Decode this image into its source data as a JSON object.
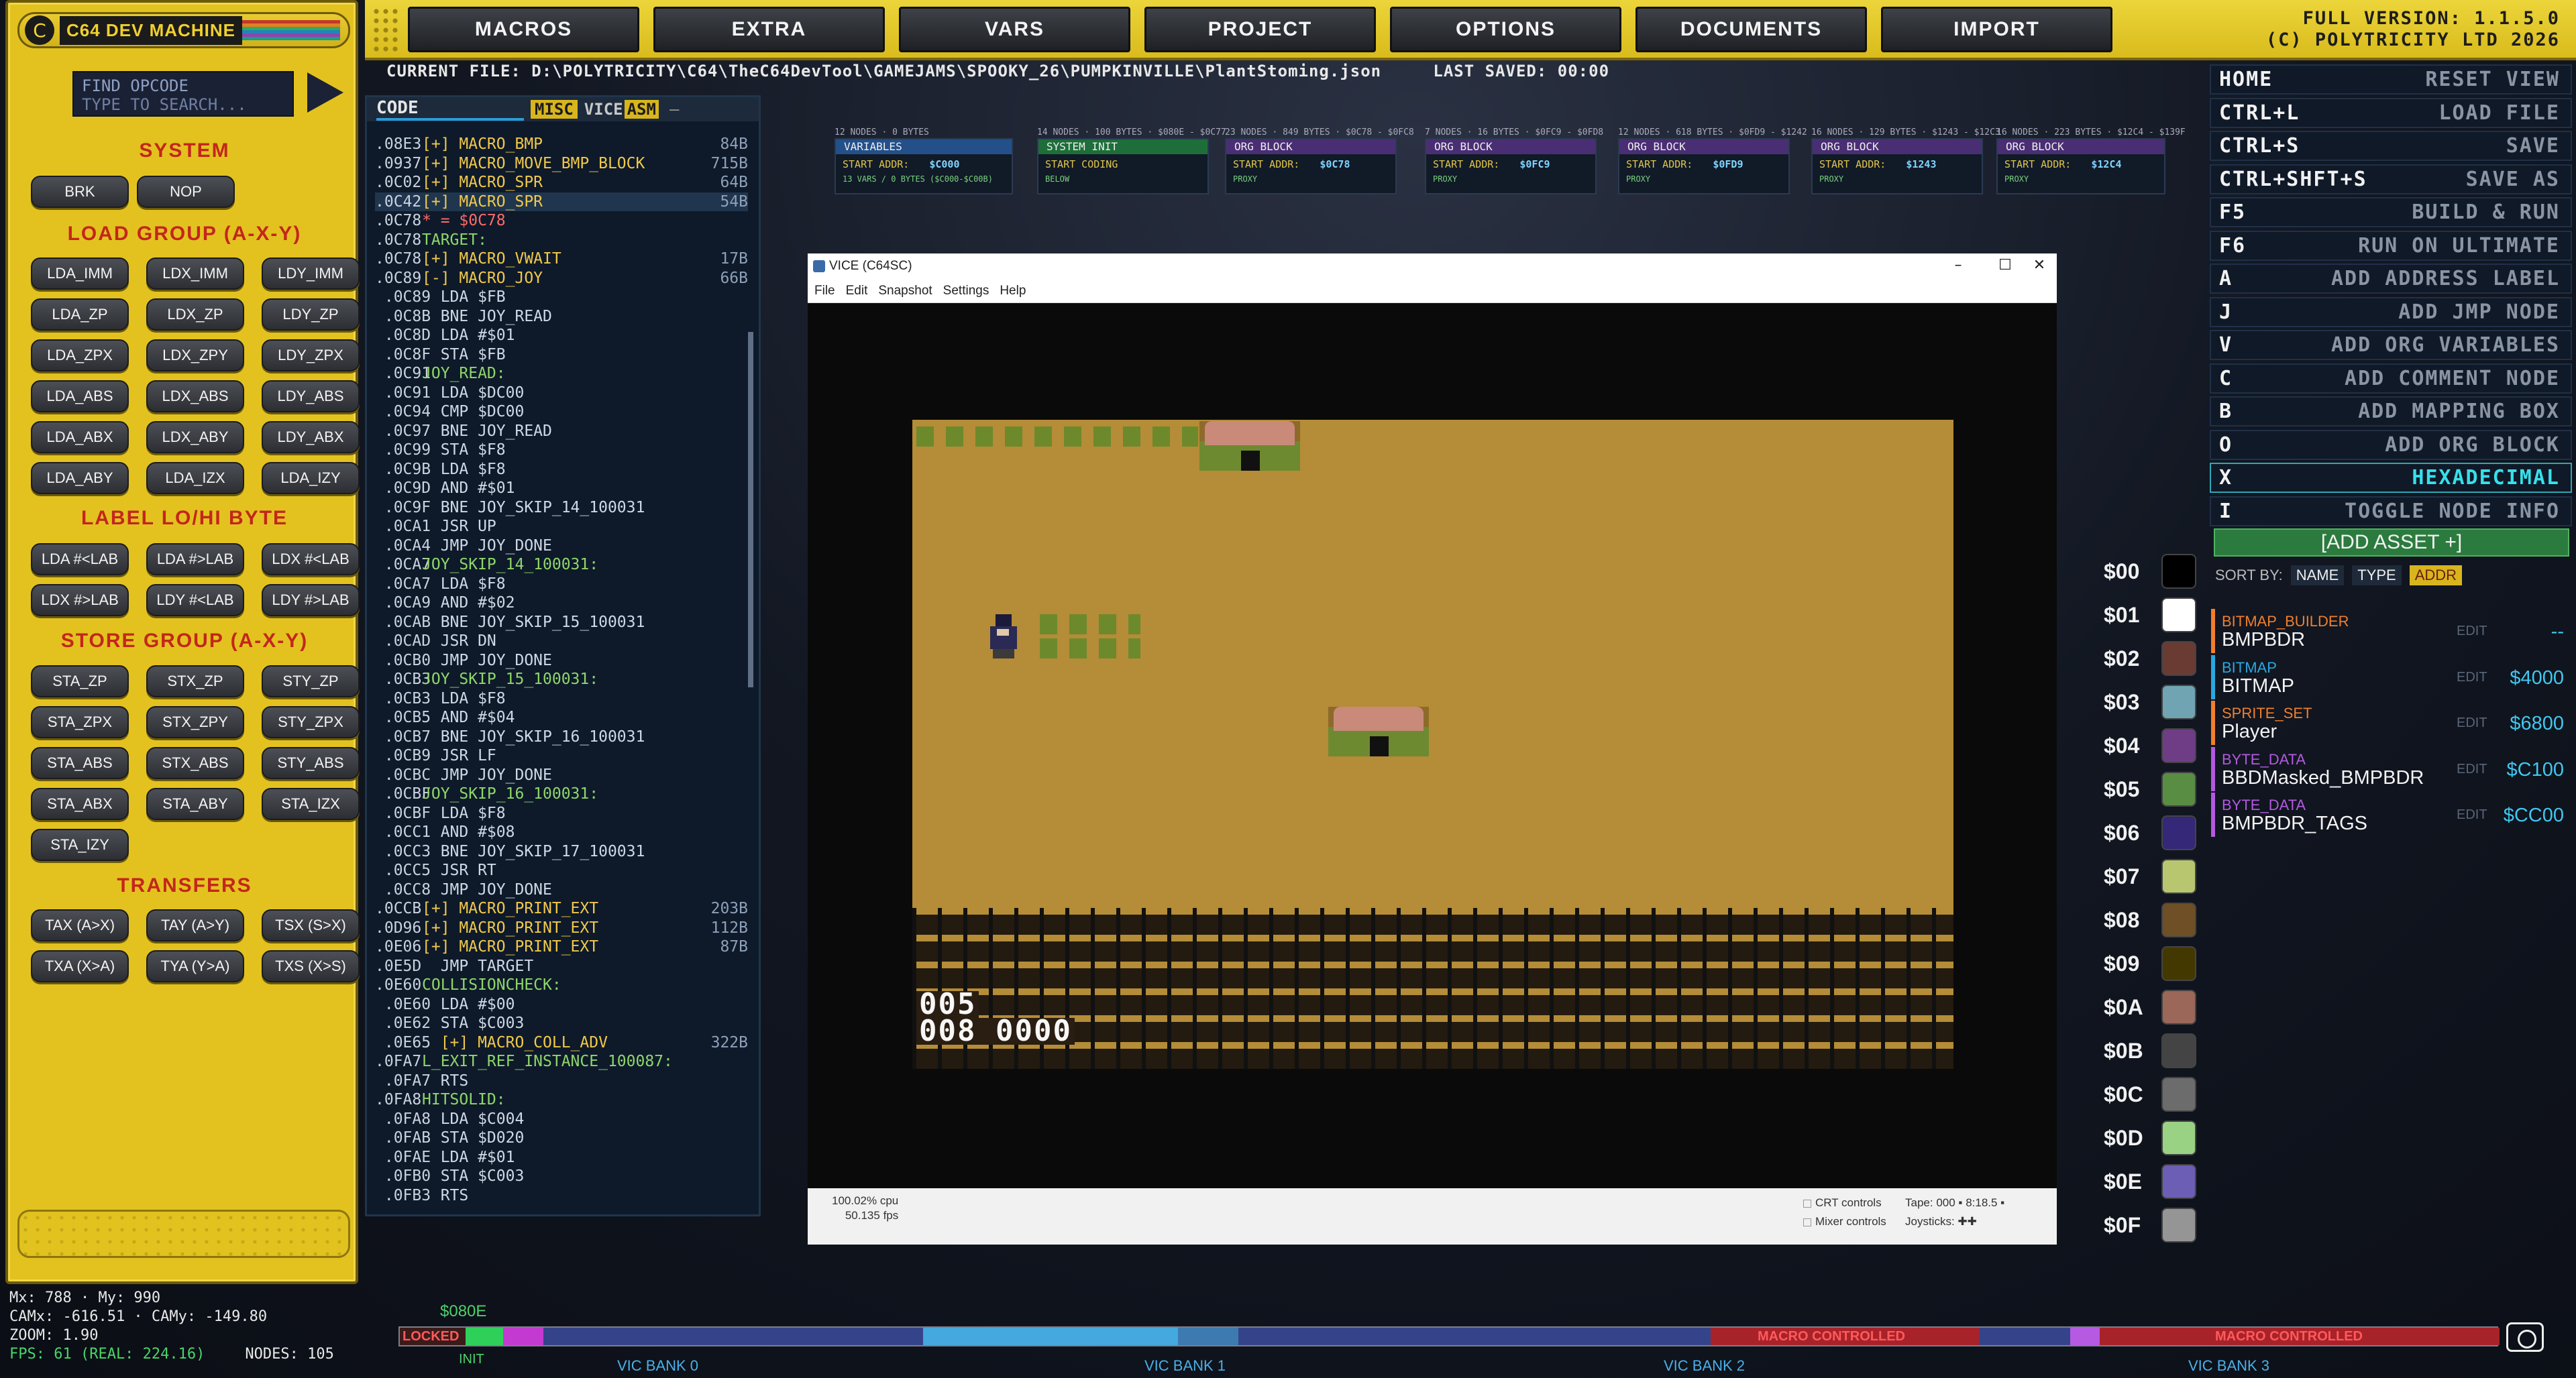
{
  "app": {
    "title": "C64 DEV MACHINE",
    "version_line1": "FULL VERSION: 1.1.5.0",
    "version_line2": "(C) POLYTRICITY LTD 2026"
  },
  "menu": [
    "MACROS",
    "EXTRA",
    "VARS",
    "PROJECT",
    "OPTIONS",
    "DOCUMENTS",
    "IMPORT"
  ],
  "file": {
    "label": "CURRENT FILE: D:\\POLYTRICITY\\C64\\TheC64DevTool\\GAMEJAMS\\SPOOKY_26\\PUMPKINVILLE\\PlantStoming.json",
    "saved": "LAST SAVED: 00:00"
  },
  "search": {
    "label": "FIND OPCODE",
    "placeholder": "TYPE TO SEARCH..."
  },
  "sections": {
    "system": "SYSTEM",
    "load": "LOAD GROUP (A-X-Y)",
    "label": "LABEL LO/HI BYTE",
    "store": "STORE GROUP (A-X-Y)",
    "transfers": "TRANSFERS"
  },
  "ops": {
    "system": [
      "BRK",
      "NOP"
    ],
    "load": [
      "LDA_IMM",
      "LDX_IMM",
      "LDY_IMM",
      "LDA_ZP",
      "LDX_ZP",
      "LDY_ZP",
      "LDA_ZPX",
      "LDX_ZPY",
      "LDY_ZPX",
      "LDA_ABS",
      "LDX_ABS",
      "LDY_ABS",
      "LDA_ABX",
      "LDX_ABY",
      "LDY_ABX",
      "LDA_ABY",
      "LDA_IZX",
      "LDA_IZY"
    ],
    "label": [
      "LDA #<LAB",
      "LDA #>LAB",
      "LDX #<LAB",
      "LDX #>LAB",
      "LDY #<LAB",
      "LDY #>LAB"
    ],
    "store": [
      "STA_ZP",
      "STX_ZP",
      "STY_ZP",
      "STA_ZPX",
      "STX_ZPY",
      "STY_ZPX",
      "STA_ABS",
      "STX_ABS",
      "STY_ABS",
      "STA_ABX",
      "STA_ABY",
      "STA_IZX",
      "STA_IZY"
    ],
    "transfers": [
      "TAX (A>X)",
      "TAY (A>Y)",
      "TSX (S>X)",
      "TXA (X>A)",
      "TYA (Y>A)",
      "TXS (X>S)"
    ]
  },
  "code_tabs": {
    "code": "CODE",
    "misc": "MISC",
    "vice": "VICE",
    "asm": "ASM",
    "dash": "—"
  },
  "code": [
    {
      "a": ".08E3",
      "t": "[+] MACRO_BMP",
      "s": "84B",
      "k": "macro"
    },
    {
      "a": ".0937",
      "t": "[+] MACRO_MOVE_BMP_BLOCK",
      "s": "715B",
      "k": "macro"
    },
    {
      "a": ".0C02",
      "t": "[+] MACRO_SPR",
      "s": "64B",
      "k": "macro"
    },
    {
      "a": ".0C42",
      "t": "[+] MACRO_SPR",
      "s": "54B",
      "k": "macro",
      "h": true
    },
    {
      "a": ".0C78",
      "t": "* = $0C78",
      "s": "",
      "k": "red"
    },
    {
      "a": ".0C78",
      "t": "TARGET:",
      "s": "",
      "k": "label",
      "n": true
    },
    {
      "a": ".0C78",
      "t": "[+] MACRO_VWAIT",
      "s": "17B",
      "k": "macro"
    },
    {
      "a": ".0C89",
      "t": "[-] MACRO_JOY",
      "s": "66B",
      "k": "macro"
    },
    {
      "a": " .0C89",
      "t": "  LDA $FB",
      "s": "",
      "k": "op"
    },
    {
      "a": " .0C8B",
      "t": "  BNE JOY_READ",
      "s": "",
      "k": "op"
    },
    {
      "a": " .0C8D",
      "t": "  LDA #$01",
      "s": "",
      "k": "op"
    },
    {
      "a": " .0C8F",
      "t": "  STA $FB",
      "s": "",
      "k": "op"
    },
    {
      "a": " .0C91",
      "t": "JOY_READ:",
      "s": "",
      "k": "label"
    },
    {
      "a": " .0C91",
      "t": "  LDA $DC00",
      "s": "",
      "k": "op"
    },
    {
      "a": " .0C94",
      "t": "  CMP $DC00",
      "s": "",
      "k": "op"
    },
    {
      "a": " .0C97",
      "t": "  BNE JOY_READ",
      "s": "",
      "k": "op"
    },
    {
      "a": " .0C99",
      "t": "  STA $F8",
      "s": "",
      "k": "op"
    },
    {
      "a": " .0C9B",
      "t": "  LDA $F8",
      "s": "",
      "k": "op"
    },
    {
      "a": " .0C9D",
      "t": "  AND #$01",
      "s": "",
      "k": "op"
    },
    {
      "a": " .0C9F",
      "t": "  BNE JOY_SKIP_14_100031",
      "s": "",
      "k": "op"
    },
    {
      "a": " .0CA1",
      "t": "  JSR UP",
      "s": "",
      "k": "op"
    },
    {
      "a": " .0CA4",
      "t": "  JMP JOY_DONE",
      "s": "",
      "k": "op"
    },
    {
      "a": " .0CA7",
      "t": "JOY_SKIP_14_100031:",
      "s": "",
      "k": "label"
    },
    {
      "a": " .0CA7",
      "t": "  LDA $F8",
      "s": "",
      "k": "op"
    },
    {
      "a": " .0CA9",
      "t": "  AND #$02",
      "s": "",
      "k": "op"
    },
    {
      "a": " .0CAB",
      "t": "  BNE JOY_SKIP_15_100031",
      "s": "",
      "k": "op"
    },
    {
      "a": " .0CAD",
      "t": "  JSR DN",
      "s": "",
      "k": "op"
    },
    {
      "a": " .0CB0",
      "t": "  JMP JOY_DONE",
      "s": "",
      "k": "op"
    },
    {
      "a": " .0CB3",
      "t": "JOY_SKIP_15_100031:",
      "s": "",
      "k": "label"
    },
    {
      "a": " .0CB3",
      "t": "  LDA $F8",
      "s": "",
      "k": "op"
    },
    {
      "a": " .0CB5",
      "t": "  AND #$04",
      "s": "",
      "k": "op"
    },
    {
      "a": " .0CB7",
      "t": "  BNE JOY_SKIP_16_100031",
      "s": "",
      "k": "op"
    },
    {
      "a": " .0CB9",
      "t": "  JSR LF",
      "s": "",
      "k": "op"
    },
    {
      "a": " .0CBC",
      "t": "  JMP JOY_DONE",
      "s": "",
      "k": "op"
    },
    {
      "a": " .0CBF",
      "t": "JOY_SKIP_16_100031:",
      "s": "",
      "k": "label"
    },
    {
      "a": " .0CBF",
      "t": "  LDA $F8",
      "s": "",
      "k": "op"
    },
    {
      "a": " .0CC1",
      "t": "  AND #$08",
      "s": "",
      "k": "op"
    },
    {
      "a": " .0CC3",
      "t": "  BNE JOY_SKIP_17_100031",
      "s": "",
      "k": "op"
    },
    {
      "a": " .0CC5",
      "t": "  JSR RT",
      "s": "",
      "k": "op"
    },
    {
      "a": " .0CC8",
      "t": "  JMP JOY_DONE",
      "s": "",
      "k": "op"
    },
    {
      "a": ".0CCB",
      "t": "[+] MACRO_PRINT_EXT",
      "s": "203B",
      "k": "macro"
    },
    {
      "a": ".0D96",
      "t": "[+] MACRO_PRINT_EXT",
      "s": "112B",
      "k": "macro"
    },
    {
      "a": ".0E06",
      "t": "[+] MACRO_PRINT_EXT",
      "s": "87B",
      "k": "macro"
    },
    {
      "a": ".0E5D",
      "t": "  JMP TARGET",
      "s": "",
      "k": "op"
    },
    {
      "a": ".0E60",
      "t": "COLLISIONCHECK:",
      "s": "",
      "k": "label",
      "n": true
    },
    {
      "a": " .0E60",
      "t": "  LDA #$00",
      "s": "",
      "k": "op"
    },
    {
      "a": " .0E62",
      "t": "  STA $C003",
      "s": "",
      "k": "op"
    },
    {
      "a": " .0E65",
      "t": "  [+] MACRO_COLL_ADV",
      "s": "322B",
      "k": "macro"
    },
    {
      "a": ".0FA7",
      "t": "L_EXIT_REF_INSTANCE_100087:",
      "s": "",
      "k": "label",
      "n": true
    },
    {
      "a": " .0FA7",
      "t": "  RTS",
      "s": "",
      "k": "op"
    },
    {
      "a": ".0FA8",
      "t": "HITSOLID:",
      "s": "",
      "k": "label",
      "n": true
    },
    {
      "a": " .0FA8",
      "t": "  LDA $C004",
      "s": "",
      "k": "op"
    },
    {
      "a": " .0FAB",
      "t": "  STA $D020",
      "s": "",
      "k": "op"
    },
    {
      "a": " .0FAE",
      "t": "  LDA #$01",
      "s": "",
      "k": "op"
    },
    {
      "a": " .0FB0",
      "t": "  STA $C003",
      "s": "",
      "k": "op"
    },
    {
      "a": " .0FB3",
      "t": "  RTS",
      "s": "",
      "k": "op"
    }
  ],
  "nodes": [
    {
      "cap": "12 NODES · 0 BYTES",
      "title": "VARIABLES",
      "k": "START ADDR:",
      "v": "$C000",
      "color": "#24508a",
      "foot": "13 VARS / 0 BYTES ($C000-$C00B)"
    },
    {
      "cap": "14 NODES · 100 BYTES · $080E - $0C77",
      "title": "SYSTEM INIT",
      "k": "START CODING",
      "v": "",
      "color": "#1e6e3a",
      "foot": "BELOW"
    },
    {
      "cap": "23 NODES · 849 BYTES · $0C78 - $0FC8",
      "title": "ORG BLOCK",
      "k": "START ADDR:",
      "v": "$0C78",
      "color": "#4a2e74",
      "foot": "PROXY"
    },
    {
      "cap": "7 NODES · 16 BYTES · $0FC9 - $0FD8",
      "title": "ORG BLOCK",
      "k": "START ADDR:",
      "v": "$0FC9",
      "color": "#4a2e74",
      "foot": "PROXY"
    },
    {
      "cap": "12 NODES · 618 BYTES · $0FD9 - $1242",
      "title": "ORG BLOCK",
      "k": "START ADDR:",
      "v": "$0FD9",
      "color": "#4a2e74",
      "foot": "PROXY"
    },
    {
      "cap": "16 NODES · 129 BYTES · $1243 - $12C3",
      "title": "ORG BLOCK",
      "k": "START ADDR:",
      "v": "$1243",
      "color": "#4a2e74",
      "foot": "PROXY"
    },
    {
      "cap": "16 NODES · 223 BYTES · $12C4 - $139F",
      "title": "ORG BLOCK",
      "k": "START ADDR:",
      "v": "$12C4",
      "color": "#4a2e74",
      "foot": "PROXY"
    }
  ],
  "vice": {
    "title": "VICE (C64SC)",
    "menu": [
      "File",
      "Edit",
      "Snapshot",
      "Settings",
      "Help"
    ],
    "min": "–",
    "max": "☐",
    "close": "✕",
    "cpu": "100.02% cpu",
    "fps": "50.135 fps",
    "crt": "CRT controls",
    "mixer": "Mixer controls",
    "tape": "Tape:",
    "tape_val": "000",
    "drive": "8:18.5",
    "joysticks": "Joysticks:",
    "score1": "005",
    "score2": "008",
    "score3": "0000"
  },
  "shortcuts": [
    {
      "key": "HOME",
      "act": "RESET VIEW"
    },
    {
      "key": "CTRL+L",
      "act": "LOAD FILE"
    },
    {
      "key": "CTRL+S",
      "act": "SAVE"
    },
    {
      "key": "CTRL+SHFT+S",
      "act": "SAVE AS"
    },
    {
      "key": "F5",
      "act": "BUILD & RUN"
    },
    {
      "key": "F6",
      "act": "RUN ON ULTIMATE"
    },
    {
      "key": "A",
      "act": "ADD ADDRESS LABEL"
    },
    {
      "key": "J",
      "act": "ADD JMP NODE"
    },
    {
      "key": "V",
      "act": "ADD ORG VARIABLES"
    },
    {
      "key": "C",
      "act": "ADD COMMENT NODE"
    },
    {
      "key": "B",
      "act": "ADD MAPPING BOX"
    },
    {
      "key": "O",
      "act": "ADD ORG BLOCK"
    },
    {
      "key": "X",
      "act": "HEXADECIMAL",
      "on": true
    },
    {
      "key": "I",
      "act": "TOGGLE NODE INFO"
    }
  ],
  "assets": {
    "add": "[ADD ASSET +]",
    "sort_label": "SORT BY:",
    "sort": [
      "NAME",
      "TYPE",
      "ADDR"
    ],
    "active_sort": "ADDR",
    "items": [
      {
        "type": "BITMAP_BUILDER",
        "name": "BMPBDR",
        "edit": "EDIT",
        "addr": "--",
        "color": "#f07f2e"
      },
      {
        "type": "BITMAP",
        "name": "BITMAP",
        "edit": "EDIT",
        "addr": "$4000",
        "color": "#2aa8e0"
      },
      {
        "type": "SPRITE_SET",
        "name": "Player",
        "edit": "EDIT",
        "addr": "$6800",
        "color": "#f07f2e"
      },
      {
        "type": "BYTE_DATA",
        "name": "BBDMasked_BMPBDR",
        "edit": "EDIT",
        "addr": "$C100",
        "color": "#b35ae0"
      },
      {
        "type": "BYTE_DATA",
        "name": "BMPBDR_TAGS",
        "edit": "EDIT",
        "addr": "$CC00",
        "color": "#b35ae0"
      }
    ]
  },
  "palette": [
    {
      "label": "$00",
      "color": "#000000"
    },
    {
      "label": "$01",
      "color": "#ffffff"
    },
    {
      "label": "$02",
      "color": "#6a3b32"
    },
    {
      "label": "$03",
      "color": "#70a4b2"
    },
    {
      "label": "$04",
      "color": "#6f3d86"
    },
    {
      "label": "$05",
      "color": "#588d43"
    },
    {
      "label": "$06",
      "color": "#352879"
    },
    {
      "label": "$07",
      "color": "#b8c76f"
    },
    {
      "label": "$08",
      "color": "#6f4f25"
    },
    {
      "label": "$09",
      "color": "#433900"
    },
    {
      "label": "$0A",
      "color": "#9a6759"
    },
    {
      "label": "$0B",
      "color": "#444444"
    },
    {
      "label": "$0C",
      "color": "#6c6c6c"
    },
    {
      "label": "$0D",
      "color": "#9ad284"
    },
    {
      "label": "$0E",
      "color": "#6c5eb5"
    },
    {
      "label": "$0F",
      "color": "#959595"
    }
  ],
  "stats": {
    "mouse": "Mx: 788 · My: 990",
    "cam": "CAMx: -616.51 · CAMy: -149.80",
    "zoom": "ZOOM: 1.90",
    "fps": "FPS: 61 (REAL: 224.16)",
    "nodes": "NODES: 105"
  },
  "timeline": {
    "addr": "$080E",
    "locked": "LOCKED",
    "init": "INIT",
    "macro1": "MACRO CONTROLLED",
    "macro2": "MACRO CONTROLLED",
    "banks": [
      "VIC BANK 0",
      "VIC BANK 1",
      "VIC BANK 2",
      "VIC BANK 3"
    ]
  }
}
